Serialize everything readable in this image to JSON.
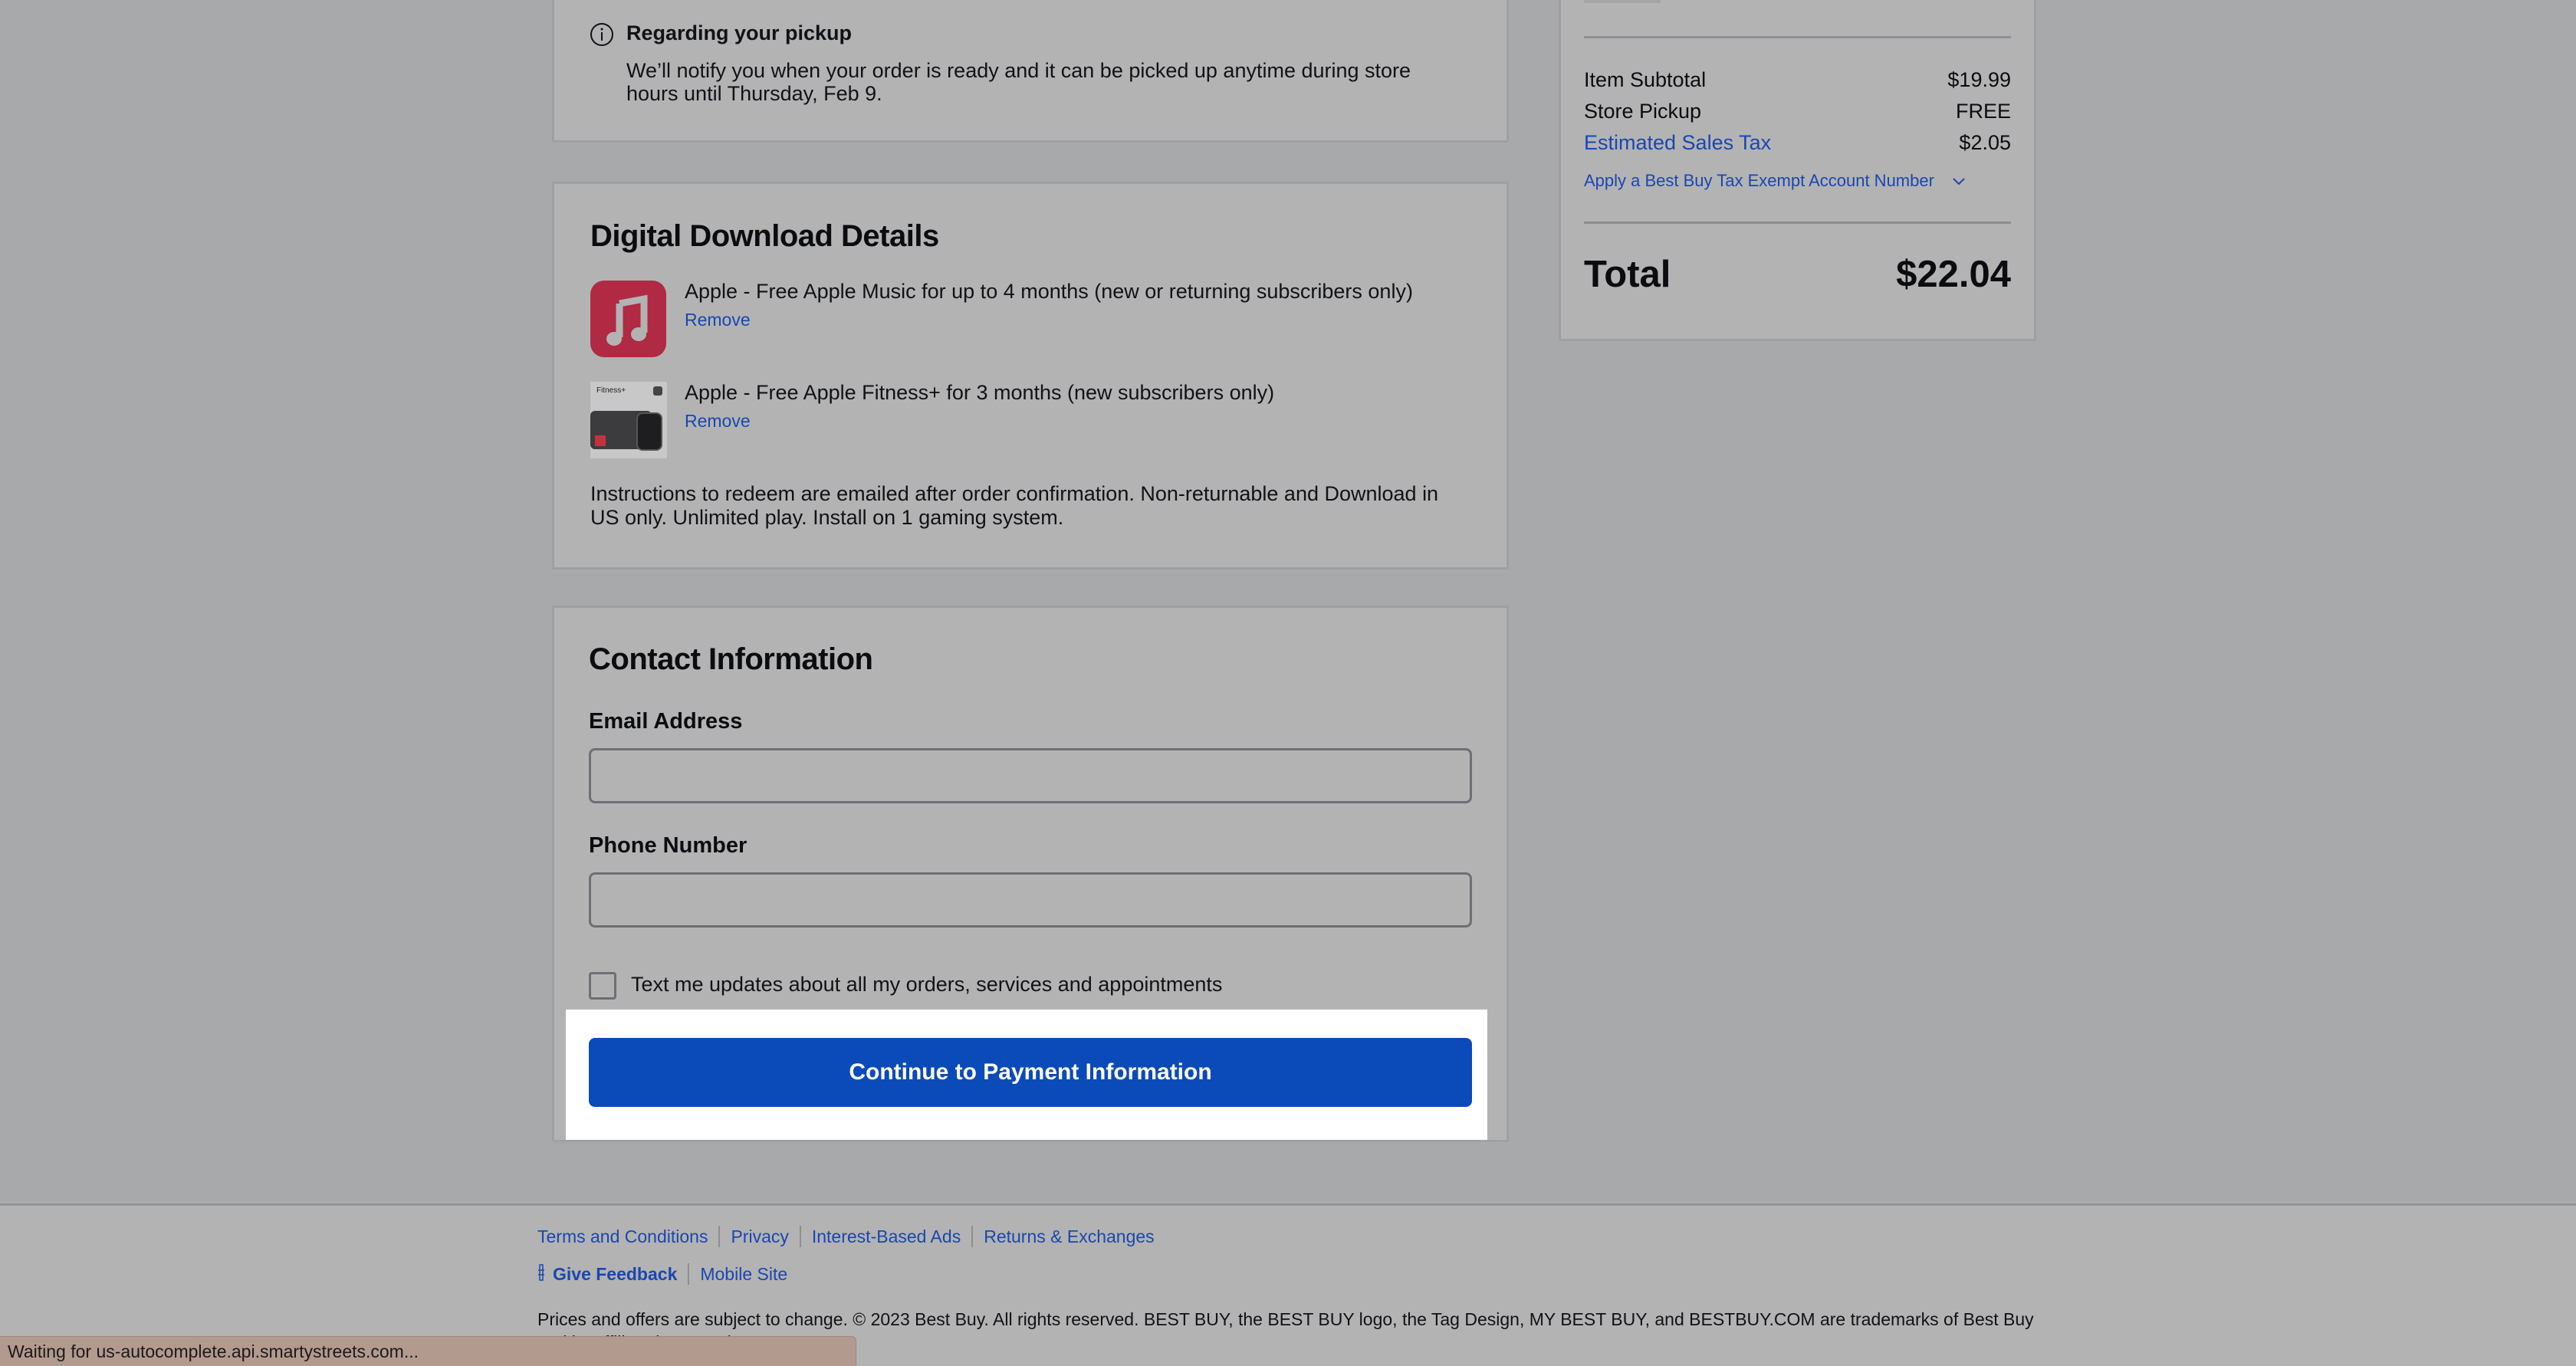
{
  "pickup_notice": {
    "title": "Regarding your pickup",
    "message": "We’ll notify you when your order is ready and it can be picked up anytime during store hours until Thursday, Feb 9.",
    "icon": "info-icon"
  },
  "digital_downloads": {
    "heading": "Digital Download Details",
    "items": [
      {
        "title": "Apple - Free Apple Music for up to 4 months (new or returning subscribers only)",
        "remove_label": "Remove",
        "icon": "apple-music-icon"
      },
      {
        "title": "Apple - Free Apple Fitness+ for 3 months (new subscribers only)",
        "remove_label": "Remove",
        "icon": "apple-fitness-thumbnail",
        "thumb_caption": "Fitness+"
      }
    ],
    "instructions": "Instructions to redeem are emailed after order confirmation. Non-returnable and Download in US only. Unlimited play. Install on 1 gaming system."
  },
  "contact": {
    "heading": "Contact Information",
    "email_label": "Email Address",
    "email_value": "",
    "phone_label": "Phone Number",
    "phone_value": "",
    "sms_opt_in_label": "Text me updates about all my orders, services and appointments",
    "sms_opt_in_checked": false,
    "continue_button": "Continue to Payment Information"
  },
  "order_summary": {
    "rows": [
      {
        "label": "Item Subtotal",
        "value": "$19.99"
      },
      {
        "label": "Store Pickup",
        "value": "FREE"
      },
      {
        "label": "Estimated Sales Tax",
        "value": "$2.05"
      }
    ],
    "tax_exempt_link": "Apply a Best Buy Tax Exempt Account Number",
    "total_label": "Total",
    "total_value": "$22.04"
  },
  "footer": {
    "links": [
      "Terms and Conditions",
      "Privacy",
      "Interest-Based Ads",
      "Returns & Exchanges"
    ],
    "feedback_label": "Give Feedback",
    "mobile_site_label": "Mobile Site",
    "legal": "Prices and offers are subject to change. © 2023 Best Buy. All rights reserved. BEST BUY, the BEST BUY logo, the Tag Design, MY BEST BUY, and BESTBUY.COM are trademarks of Best Buy and its affiliated companies."
  },
  "browser_status": {
    "text": "Waiting for us-autocomplete.api.smartystreets.com..."
  },
  "colors": {
    "primary_button": "#0b4ab9",
    "link": "#1a47b0",
    "overlay_background": "#a8a9ab",
    "card_background": "#b3b3b3",
    "highlight": "#ffffff",
    "apple_music_red": "#b02a44"
  }
}
